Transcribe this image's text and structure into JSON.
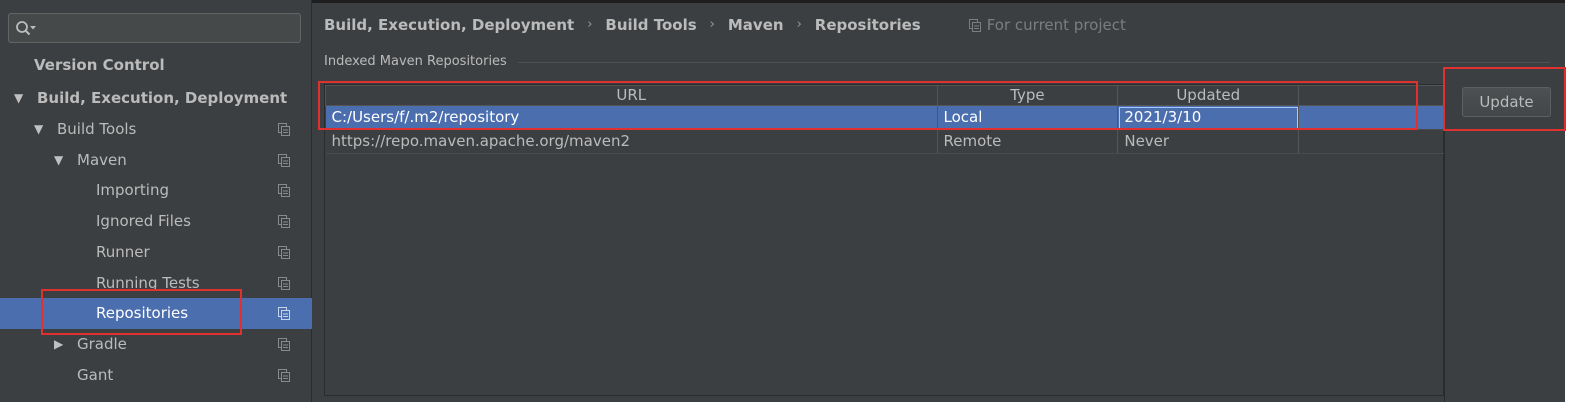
{
  "search": {
    "placeholder": "",
    "value": ""
  },
  "sidebar": {
    "items": [
      {
        "label": "Version Control",
        "arrow": "",
        "bold": true
      },
      {
        "label": "Build, Execution, Deployment",
        "arrow": "▼",
        "bold": true
      },
      {
        "label": "Build Tools",
        "arrow": "▼"
      },
      {
        "label": "Maven",
        "arrow": "▼"
      },
      {
        "label": "Importing",
        "arrow": ""
      },
      {
        "label": "Ignored Files",
        "arrow": ""
      },
      {
        "label": "Runner",
        "arrow": ""
      },
      {
        "label": "Running Tests",
        "arrow": ""
      },
      {
        "label": "Repositories",
        "arrow": "",
        "selected": true
      },
      {
        "label": "Gradle",
        "arrow": "▶"
      },
      {
        "label": "Gant",
        "arrow": ""
      }
    ]
  },
  "breadcrumb": {
    "items": [
      "Build, Execution, Deployment",
      "Build Tools",
      "Maven",
      "Repositories"
    ],
    "separator": "›",
    "scope": "For current project"
  },
  "section": {
    "title": "Indexed Maven Repositories"
  },
  "table": {
    "headers": {
      "url": "URL",
      "type": "Type",
      "updated": "Updated"
    },
    "rows": [
      {
        "url": "C:/Users/f/.m2/repository",
        "type": "Local",
        "updated": "2021/3/10"
      },
      {
        "url": "https://repo.maven.apache.org/maven2",
        "type": "Remote",
        "updated": "Never"
      }
    ]
  },
  "actions": {
    "update_label": "Update"
  },
  "colors": {
    "background": "#3c3f41",
    "selection": "#4b6eaf",
    "annotation": "#e03030",
    "text": "#bbbbbb"
  }
}
